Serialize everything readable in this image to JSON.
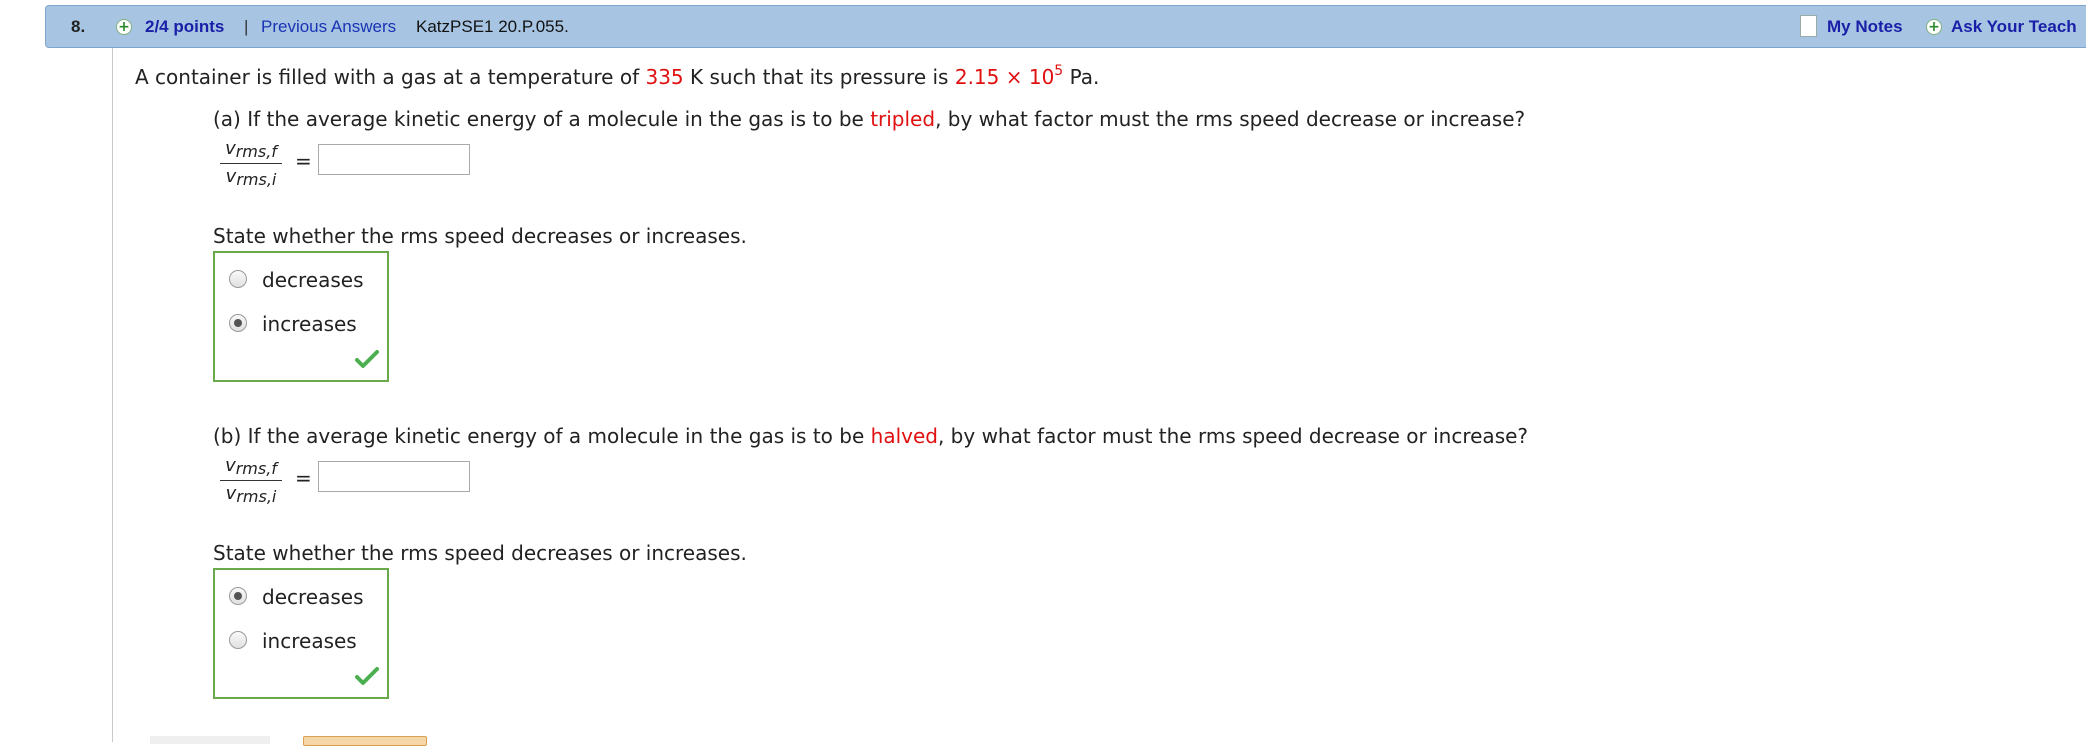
{
  "header": {
    "number": "8.",
    "points": "2/4 points",
    "separator": "|",
    "previous_answers": "Previous Answers",
    "problem_code": "KatzPSE1 20.P.055.",
    "my_notes": "My Notes",
    "ask_teacher": "Ask Your Teach"
  },
  "problem": {
    "intro_pre": "A container is filled with a gas at a temperature of ",
    "temperature": "335",
    "intro_mid": " K such that its pressure is ",
    "pressure_mantissa": "2.15 × 10",
    "pressure_exp": "5",
    "intro_post": " Pa."
  },
  "fraction": {
    "num_var": "v",
    "num_sub": "rms,f",
    "den_var": "v",
    "den_sub": "rms,i",
    "equals": "="
  },
  "part_a": {
    "question_pre": "(a) If the average kinetic energy of a molecule in the gas is to be ",
    "keyword": "tripled",
    "question_post": ", by what factor must the rms speed decrease or increase?",
    "answer_value": "",
    "state_prompt": "State whether the rms speed decreases or increases.",
    "options": [
      "decreases",
      "increases"
    ],
    "selected": "increases"
  },
  "part_b": {
    "question_pre": "(b) If the average kinetic energy of a molecule in the gas is to be ",
    "keyword": "halved",
    "question_post": ", by what factor must the rms speed decrease or increase?",
    "answer_value": "",
    "state_prompt": "State whether the rms speed decreases or increases.",
    "options": [
      "decreases",
      "increases"
    ],
    "selected": "decreases"
  },
  "colors": {
    "header_bg": "#a7c5e2",
    "link": "#1a1fa8",
    "highlight": "#e01010",
    "correct_border": "#6aaa4a",
    "check": "#4caf50"
  },
  "icons": [
    "plus-circle-icon",
    "notes-icon",
    "radio-icon",
    "checkmark-icon"
  ]
}
